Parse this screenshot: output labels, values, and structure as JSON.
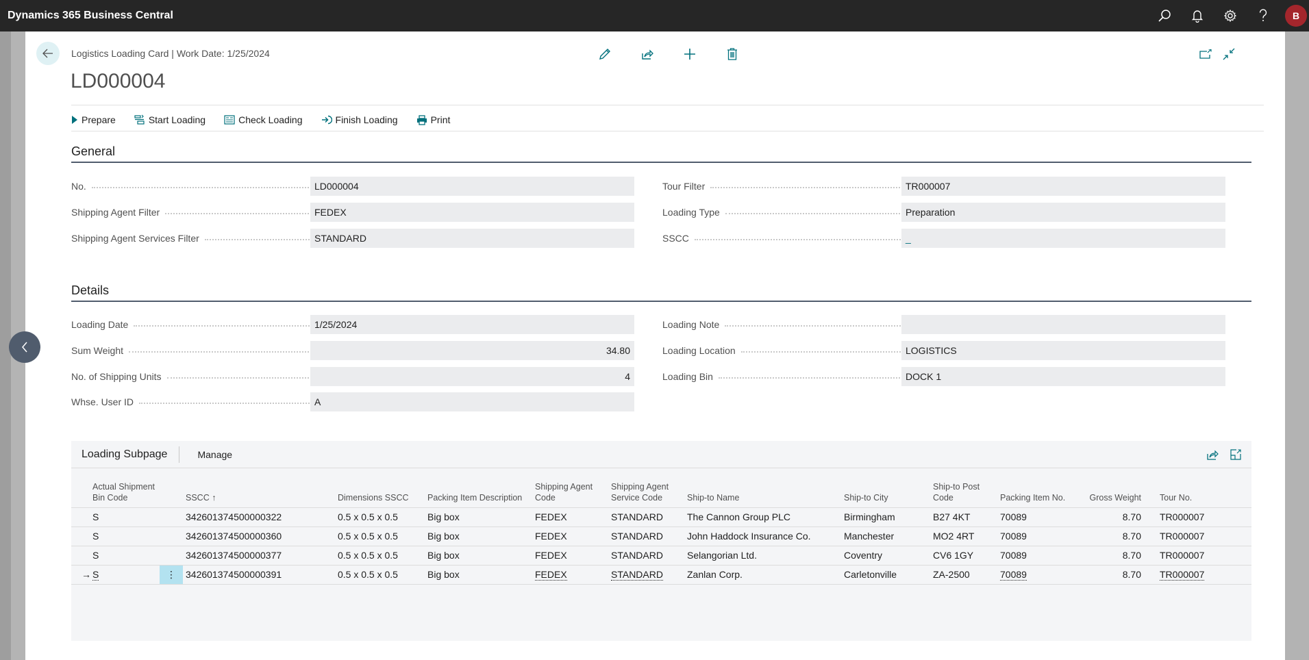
{
  "app": {
    "title": "Dynamics 365 Business Central",
    "top_icons": [
      "search-icon",
      "bell-icon",
      "gear-icon",
      "help-icon"
    ],
    "avatar_initial": "B",
    "avatar_color": "#a4262c"
  },
  "header": {
    "breadcrumb": "Logistics Loading Card | Work Date: 1/25/2024",
    "title": "LD000004",
    "center_icons": [
      "edit-icon",
      "share-icon",
      "add-icon",
      "delete-icon"
    ],
    "right_icons": [
      "open-in-new-window-icon",
      "collapse-icon"
    ]
  },
  "actions": [
    {
      "label": "Prepare",
      "icon": "play-icon"
    },
    {
      "label": "Start Loading",
      "icon": "start-loading-icon"
    },
    {
      "label": "Check Loading",
      "icon": "check-loading-icon"
    },
    {
      "label": "Finish Loading",
      "icon": "finish-loading-icon"
    },
    {
      "label": "Print",
      "icon": "print-icon"
    }
  ],
  "general": {
    "title": "General",
    "left": [
      {
        "label": "No.",
        "value": "LD000004"
      },
      {
        "label": "Shipping Agent Filter",
        "value": "FEDEX"
      },
      {
        "label": "Shipping Agent Services Filter",
        "value": "STANDARD"
      }
    ],
    "right": [
      {
        "label": "Tour Filter",
        "value": "TR000007"
      },
      {
        "label": "Loading Type",
        "value": "Preparation"
      },
      {
        "label": "SSCC",
        "value": "_"
      }
    ]
  },
  "details": {
    "title": "Details",
    "left": [
      {
        "label": "Loading Date",
        "value": "1/25/2024"
      },
      {
        "label": "Sum Weight",
        "value": "34.80"
      },
      {
        "label": "No. of Shipping Units",
        "value": "4"
      },
      {
        "label": "Whse. User ID",
        "value": "A"
      }
    ],
    "right": [
      {
        "label": "Loading Note",
        "value": ""
      },
      {
        "label": "Loading Location",
        "value": "LOGISTICS"
      },
      {
        "label": "Loading Bin",
        "value": "DOCK 1"
      }
    ]
  },
  "subpage": {
    "title": "Loading Subpage",
    "manage_label": "Manage",
    "columns": [
      "Actual Shipment Bin Code",
      "SSCC ↑",
      "Dimensions SSCC",
      "Packing Item Description",
      "Shipping Agent Code",
      "Shipping Agent Service Code",
      "Ship-to Name",
      "Ship-to City",
      "Ship-to Post Code",
      "Packing Item No.",
      "Gross Weight",
      "Tour No."
    ],
    "rows": [
      [
        "S",
        "342601374500000322",
        "0.5 x 0.5 x 0.5",
        "Big box",
        "FEDEX",
        "STANDARD",
        "The Cannon Group PLC",
        "Birmingham",
        "B27 4KT",
        "70089",
        "8.70",
        "TR000007"
      ],
      [
        "S",
        "342601374500000360",
        "0.5 x 0.5 x 0.5",
        "Big box",
        "FEDEX",
        "STANDARD",
        "John Haddock Insurance Co.",
        "Manchester",
        "MO2 4RT",
        "70089",
        "8.70",
        "TR000007"
      ],
      [
        "S",
        "342601374500000377",
        "0.5 x 0.5 x 0.5",
        "Big box",
        "FEDEX",
        "STANDARD",
        "Selangorian Ltd.",
        "Coventry",
        "CV6 1GY",
        "70089",
        "8.70",
        "TR000007"
      ],
      [
        "S",
        "342601374500000391",
        "0.5 x 0.5 x 0.5",
        "Big box",
        "FEDEX",
        "STANDARD",
        "Zanlan Corp.",
        "Carletonville",
        "ZA-2500",
        "70089",
        "8.70",
        "TR000007"
      ]
    ],
    "active_row": 3,
    "active_row_marker": "→",
    "row_menu_glyph": "⋮"
  },
  "colors": {
    "accent": "#00707c",
    "topbar": "#262626",
    "section_line": "#505c6d",
    "field_bg": "#ebecee",
    "active_cell": "#b3e2f0"
  }
}
